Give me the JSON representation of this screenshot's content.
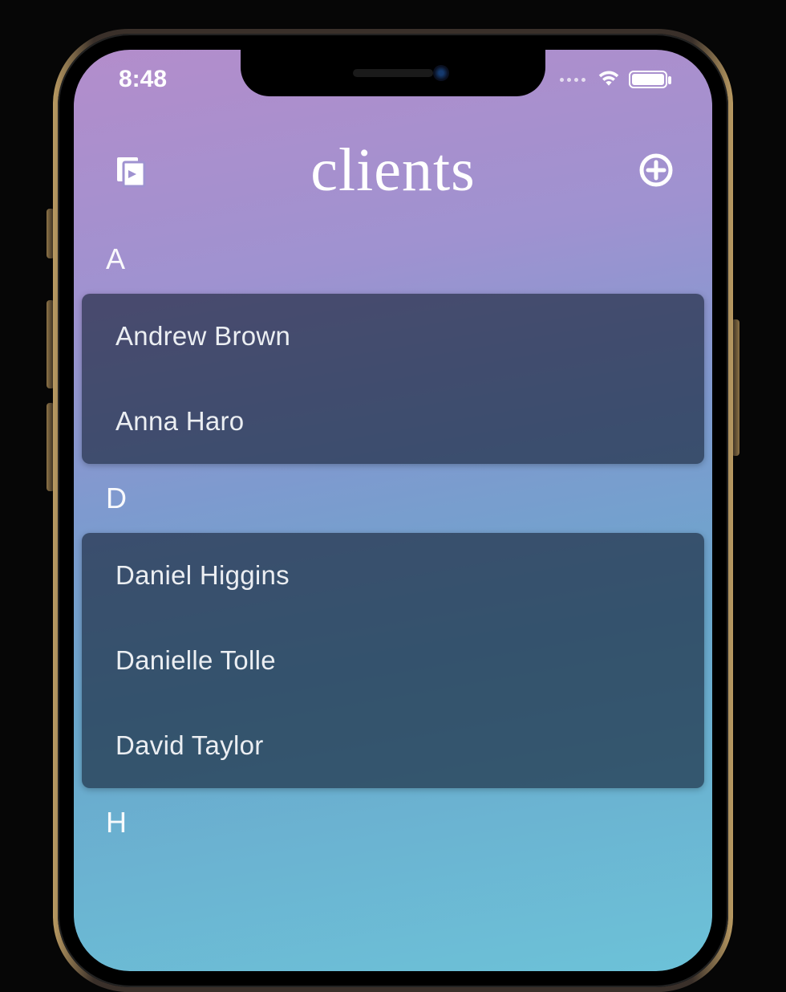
{
  "status": {
    "time": "8:48"
  },
  "nav": {
    "title": "clients"
  },
  "sections": [
    {
      "letter": "A",
      "items": [
        "Andrew Brown",
        "Anna Haro"
      ]
    },
    {
      "letter": "D",
      "items": [
        "Daniel Higgins",
        "Danielle Tolle",
        "David Taylor"
      ]
    },
    {
      "letter": "H",
      "items": []
    }
  ]
}
